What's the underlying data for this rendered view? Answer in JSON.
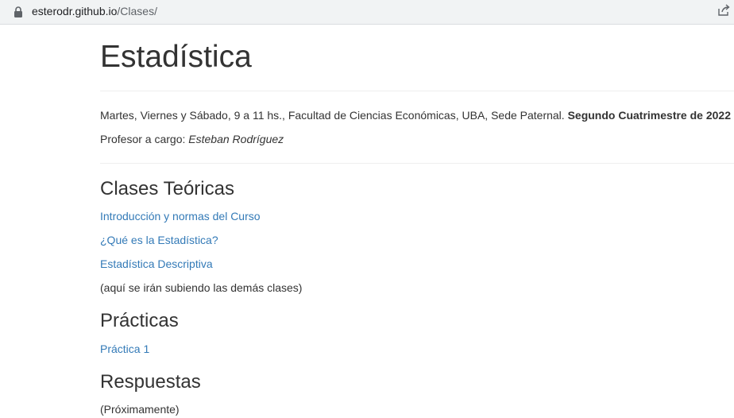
{
  "browser": {
    "url_host": "esterodr.github.io",
    "url_path": "/Clases/",
    "icons": [
      "lock-icon",
      "share-icon"
    ]
  },
  "page": {
    "title": "Estadística",
    "schedule_text": "Martes, Viernes y Sábado, 9 a 11 hs., Facultad de Ciencias Económicas, UBA, Sede Paternal.",
    "schedule_bold": "Segundo Cuatrimestre de 2022",
    "teacher_label": "Profesor a cargo:",
    "teacher_name": "Esteban Rodríguez"
  },
  "teoricas": {
    "heading": "Clases Teóricas",
    "links": [
      {
        "label": "Introducción y normas del Curso"
      },
      {
        "label": "¿Qué es la Estadística?"
      },
      {
        "label": "Estadística Descriptiva"
      }
    ],
    "note": "(aquí se irán subiendo las demás clases)"
  },
  "practicas": {
    "heading": "Prácticas",
    "links": [
      {
        "label": "Práctica 1"
      }
    ]
  },
  "respuestas": {
    "heading": "Respuestas",
    "note": "(Próximamente)"
  },
  "colors": {
    "link": "#337ab7",
    "text": "#333333",
    "address_bar_bg": "#f1f3f4"
  }
}
